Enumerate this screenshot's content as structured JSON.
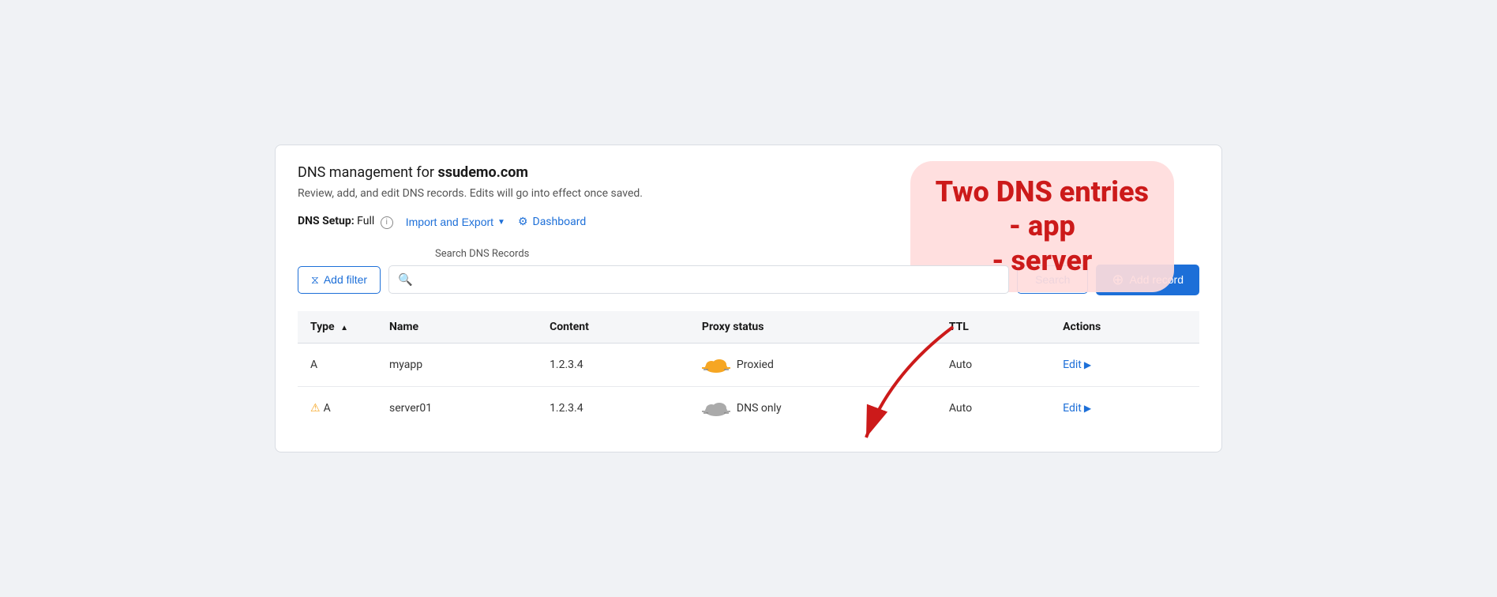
{
  "page": {
    "title": "DNS management for ",
    "title_domain": "ssudemo.com",
    "subtitle": "Review, add, and edit DNS records. Edits will go into effect once saved.",
    "dns_setup_label": "DNS Setup:",
    "dns_setup_value": "Full",
    "import_export_label": "Import and Export",
    "dashboard_label": "Dashboard",
    "search_placeholder_label": "Search DNS Records",
    "search_placeholder": "",
    "add_filter_label": "Add filter",
    "search_button_label": "Search",
    "add_record_label": "Add record"
  },
  "table": {
    "columns": [
      {
        "key": "type",
        "label": "Type",
        "sortable": true
      },
      {
        "key": "name",
        "label": "Name",
        "sortable": false
      },
      {
        "key": "content",
        "label": "Content",
        "sortable": false
      },
      {
        "key": "proxy_status",
        "label": "Proxy status",
        "sortable": false
      },
      {
        "key": "ttl",
        "label": "TTL",
        "sortable": false
      },
      {
        "key": "actions",
        "label": "Actions",
        "sortable": false
      }
    ],
    "rows": [
      {
        "type": "A",
        "warning": false,
        "name": "myapp",
        "content": "1.2.3.4",
        "proxy_status": "Proxied",
        "proxy_type": "orange",
        "ttl": "Auto",
        "edit_label": "Edit"
      },
      {
        "type": "A",
        "warning": true,
        "name": "server01",
        "content": "1.2.3.4",
        "proxy_status": "DNS only",
        "proxy_type": "gray",
        "ttl": "Auto",
        "edit_label": "Edit"
      }
    ]
  },
  "annotation": {
    "line1": "Two DNS entries",
    "line2": "- app",
    "line3": "- server"
  }
}
